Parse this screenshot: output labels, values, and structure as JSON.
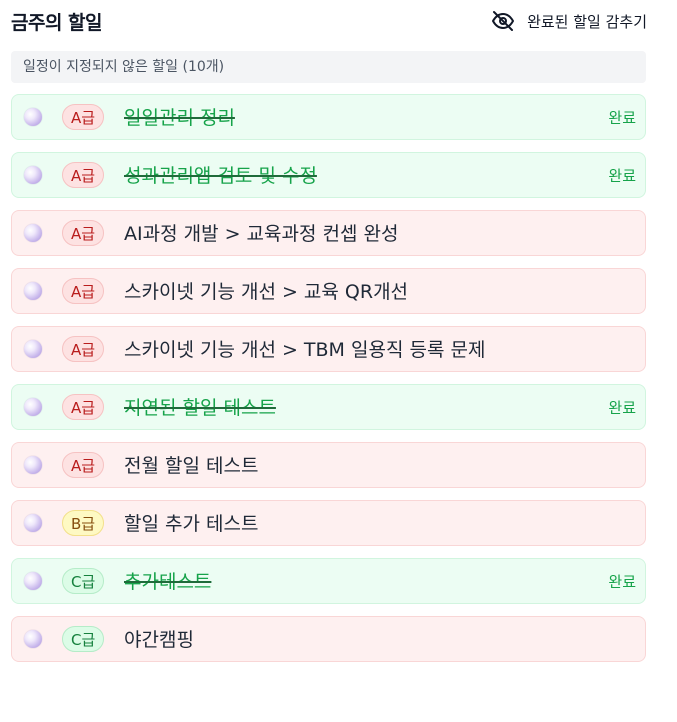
{
  "header": {
    "title": "금주의 할일",
    "hide_completed_label": "완료된 할일 감추기",
    "hide_icon": "eye-off-icon"
  },
  "section": {
    "label": "일정이 지정되지 않은 할일 (10개)"
  },
  "tasks": [
    {
      "grade": "A급",
      "text": "일일관리 정리",
      "done": true,
      "done_label": "완료"
    },
    {
      "grade": "A급",
      "text": "성과관리앱 검토 및 수정",
      "done": true,
      "done_label": "완료"
    },
    {
      "grade": "A급",
      "text": "AI과정 개발 > 교육과정 컨셉 완성",
      "done": false,
      "done_label": ""
    },
    {
      "grade": "A급",
      "text": "스카이넷 기능 개선 > 교육 QR개선",
      "done": false,
      "done_label": ""
    },
    {
      "grade": "A급",
      "text": "스카이넷 기능 개선 > TBM 일용직 등록 문제",
      "done": false,
      "done_label": ""
    },
    {
      "grade": "A급",
      "text": "지연된 할일 테스트",
      "done": true,
      "done_label": "완료"
    },
    {
      "grade": "A급",
      "text": "전월 할일 테스트",
      "done": false,
      "done_label": ""
    },
    {
      "grade": "B급",
      "text": "할일 추가 테스트",
      "done": false,
      "done_label": ""
    },
    {
      "grade": "C급",
      "text": "추가테스트",
      "done": true,
      "done_label": "완료"
    },
    {
      "grade": "C급",
      "text": "야간캠핑",
      "done": false,
      "done_label": ""
    }
  ],
  "colors": {
    "done_bg": "#ecfdf3",
    "todo_bg": "#fef0f0",
    "done_text": "#16a34a",
    "grade_a": "#b91c1c",
    "grade_b": "#854d0e",
    "grade_c": "#15803d"
  }
}
